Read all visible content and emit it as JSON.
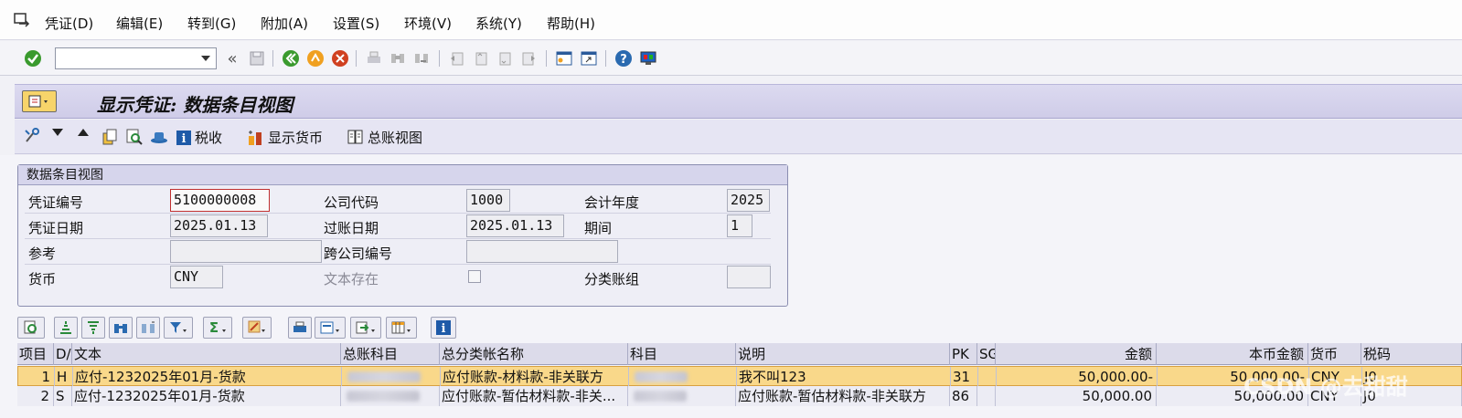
{
  "menu": {
    "items": [
      "凭证(D)",
      "编辑(E)",
      "转到(G)",
      "附加(A)",
      "设置(S)",
      "环境(V)",
      "系统(Y)",
      "帮助(H)"
    ]
  },
  "toolbar": {
    "command_value": "",
    "back_symbol": "«"
  },
  "title": "显示凭证: 数据条目视图",
  "app_toolbar": {
    "tax_label": "税收",
    "currency_label": "显示货币",
    "ledger_label": "总账视图"
  },
  "group": {
    "title": "数据条目视图",
    "labels": {
      "doc_no": "凭证编号",
      "company_code": "公司代码",
      "fiscal_year": "会计年度",
      "doc_date": "凭证日期",
      "posting_date": "过账日期",
      "period": "期间",
      "reference": "参考",
      "cross_company": "跨公司编号",
      "currency": "货币",
      "text_exists": "文本存在",
      "ledger_group": "分类账组"
    },
    "values": {
      "doc_no": "5100000008",
      "company_code": "1000",
      "fiscal_year": "2025",
      "doc_date": "2025.01.13",
      "posting_date": "2025.01.13",
      "period": "1",
      "reference": "",
      "cross_company": "",
      "currency": "CNY",
      "ledger_group": ""
    }
  },
  "grid": {
    "headers": [
      "项目",
      "D/",
      "文本",
      "总账科目",
      "总分类帐名称",
      "科目",
      "说明",
      "PK",
      "SG",
      "金额",
      "本币金额",
      "货币",
      "税码"
    ],
    "rows": [
      {
        "item": "1",
        "dc": "H",
        "text": "应付-1232025年01月-货款",
        "gl_name": "应付账款-材料款-非关联方",
        "desc": "我不叫123",
        "pk": "31",
        "sg": "",
        "amount": "50,000.00-",
        "local_amount": "50,000.00-",
        "currency": "CNY",
        "tax": "J0"
      },
      {
        "item": "2",
        "dc": "S",
        "text": "应付-1232025年01月-货款",
        "gl_name": "应付账款-暂估材料款-非关...",
        "desc": "应付账款-暂估材料款-非关联方",
        "pk": "86",
        "sg": "",
        "amount": "50,000.00",
        "local_amount": "50,000.00",
        "currency": "CNY",
        "tax": "J0"
      }
    ]
  },
  "watermark": "CSDN @去甜甜",
  "colors": {
    "selected_row": "#f9d88a",
    "title_bar": "#d6d3ee",
    "ok_green": "#3a9a2e"
  }
}
